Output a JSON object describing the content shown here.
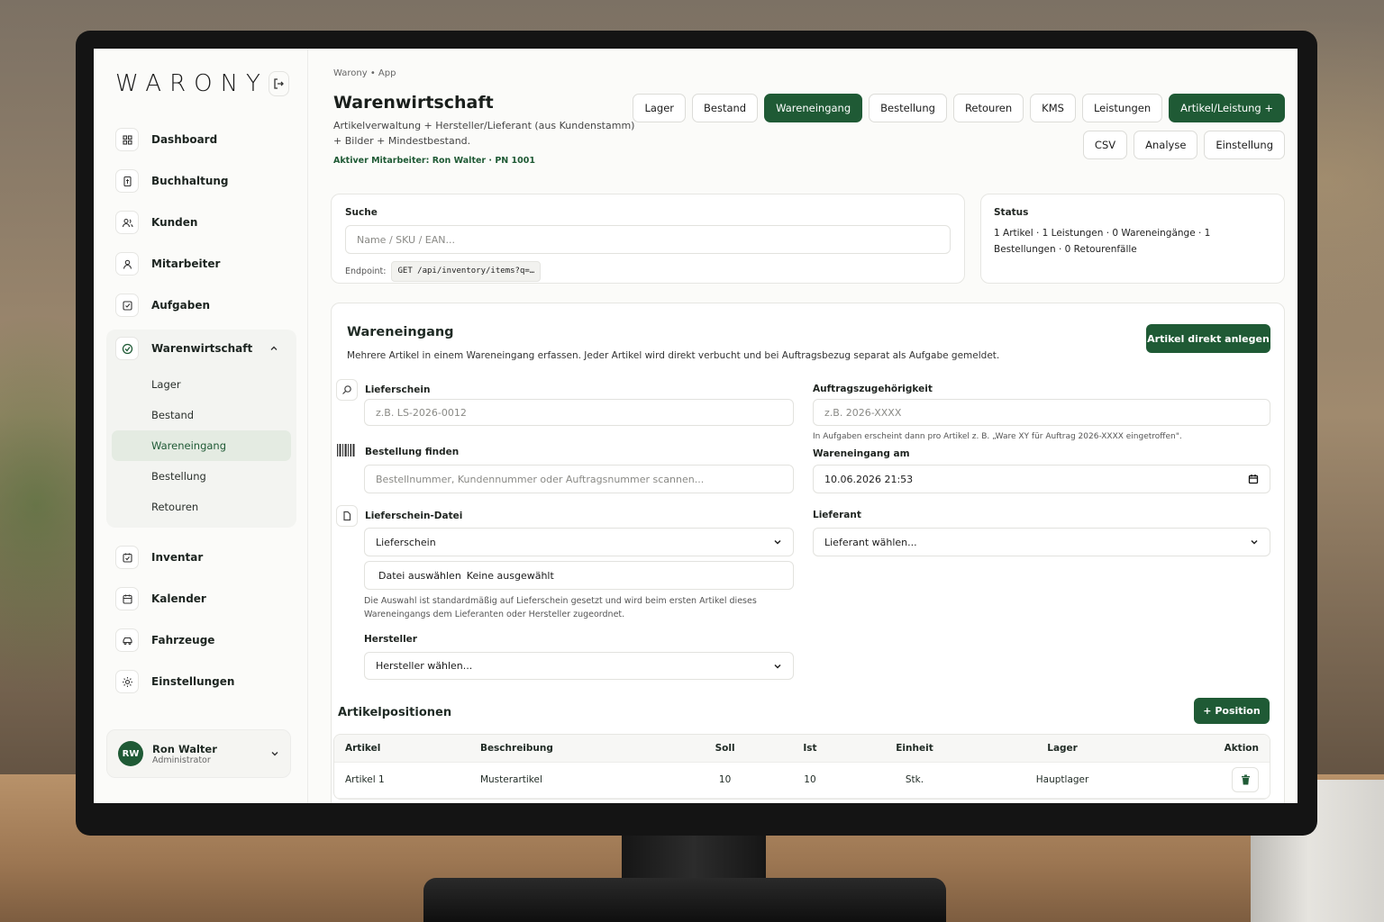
{
  "sidebar": {
    "logo": "WARONY",
    "items": [
      {
        "label": "Dashboard",
        "icon": "grid-icon"
      },
      {
        "label": "Buchhaltung",
        "icon": "ledger-icon"
      },
      {
        "label": "Kunden",
        "icon": "customers-icon"
      },
      {
        "label": "Mitarbeiter",
        "icon": "staff-icon"
      },
      {
        "label": "Aufgaben",
        "icon": "tasks-icon"
      }
    ],
    "group": {
      "label": "Warenwirtschaft",
      "sub": [
        "Lager",
        "Bestand",
        "Wareneingang",
        "Bestellung",
        "Retouren"
      ],
      "active": "Wareneingang"
    },
    "items2": [
      {
        "label": "Inventar",
        "icon": "inventory-icon"
      },
      {
        "label": "Kalender",
        "icon": "calendar-icon"
      },
      {
        "label": "Fahrzeuge",
        "icon": "vehicle-icon"
      },
      {
        "label": "Einstellungen",
        "icon": "settings-icon"
      }
    ],
    "user": {
      "initials": "RW",
      "name": "Ron Walter",
      "role": "Administrator"
    }
  },
  "header": {
    "breadcrumb": "Warony • App",
    "title": "Warenwirtschaft",
    "subtitle": "Artikelverwaltung + Hersteller/Lieferant (aus Kundenstamm) + Bilder + Mindestbestand.",
    "active_employee": "Aktiver Mitarbeiter: Ron Walter · PN 1001",
    "tabs": [
      "Lager",
      "Bestand",
      "Wareneingang",
      "Bestellung",
      "Retouren",
      "KMS",
      "Leistungen",
      "Artikel/Leistung +"
    ],
    "tabs2": [
      "CSV",
      "Analyse",
      "Einstellung"
    ]
  },
  "search": {
    "label": "Suche",
    "placeholder": "Name / SKU / EAN...",
    "endpoint_label": "Endpoint:",
    "endpoint": "GET  /api/inventory/items?q=…"
  },
  "status": {
    "label": "Status",
    "text": "1 Artikel · 1 Leistungen · 0 Wareneingänge · 1 Bestellungen · 0 Retourenfälle"
  },
  "receipt": {
    "title": "Wareneingang",
    "desc": "Mehrere Artikel in einem Wareneingang erfassen. Jeder Artikel wird direkt verbucht und bei Auftragsbezug separat als Aufgabe gemeldet.",
    "create_button": "Artikel direkt anlegen",
    "lieferschein_label": "Lieferschein",
    "lieferschein_placeholder": "z.B. LS-2026-0012",
    "order_find_label": "Bestellung finden",
    "order_find_placeholder": "Bestellnummer, Kundennummer oder Auftragsnummer scannen...",
    "file_label": "Lieferschein-Datei",
    "file_type": "Lieferschein",
    "file_button": "Datei auswählen",
    "file_none": "Keine ausgewählt",
    "file_hint": "Die Auswahl ist standardmäßig auf Lieferschein gesetzt und wird beim ersten Artikel dieses Wareneingangs dem Lieferanten oder Hersteller zugeordnet.",
    "manufacturer_label": "Hersteller",
    "manufacturer_value": "Hersteller wählen...",
    "order_label": "Auftragszugehörigkeit",
    "order_placeholder": "z.B. 2026-XXXX",
    "order_hint": "In Aufgaben erscheint dann pro Artikel z. B. „Ware XY für Auftrag 2026-XXXX eingetroffen\".",
    "date_label": "Wareneingang am",
    "date_value": "10.06.2026 21:53",
    "supplier_label": "Lieferant",
    "supplier_value": "Lieferant wählen..."
  },
  "positions": {
    "title": "Artikelpositionen",
    "add_button": "+  Position",
    "columns": [
      "Artikel",
      "Beschreibung",
      "Soll",
      "Ist",
      "Einheit",
      "Lager",
      "Aktion"
    ],
    "rows": [
      [
        "Artikel 1",
        "Musterartikel",
        "10",
        "10",
        "Stk.",
        "Hauptlager"
      ]
    ]
  },
  "colors": {
    "accent": "#1f5a35"
  }
}
